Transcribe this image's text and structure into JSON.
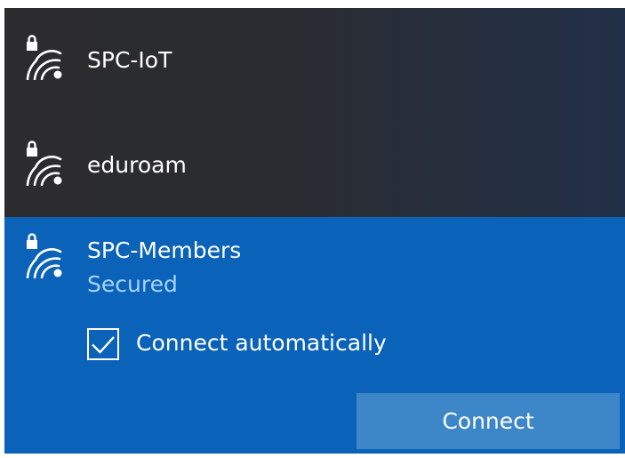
{
  "networks": [
    {
      "name": "SPC-IoT",
      "icon": "wifi-secured-icon"
    },
    {
      "name": "eduroam",
      "icon": "wifi-secured-icon"
    },
    {
      "name": "SPC-Members",
      "icon": "wifi-secured-icon",
      "status": "Secured",
      "selected": true,
      "connect_automatically": {
        "label": "Connect automatically",
        "checked": true
      },
      "connect_button": "Connect"
    }
  ],
  "colors": {
    "dark_bg": "#2a2c31",
    "selected_bg": "#0a63b8",
    "status_text": "#a9d2fb",
    "button_bg": "#3d86c8"
  }
}
